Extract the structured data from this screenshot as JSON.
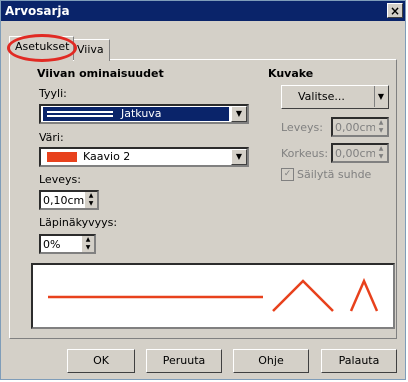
{
  "window": {
    "title": "Arvosarja",
    "close_glyph": "×"
  },
  "tabs": [
    {
      "label": "Asetukset"
    },
    {
      "label": "Viiva"
    }
  ],
  "line_props": {
    "heading": "Viivan ominaisuudet",
    "style_label": "Tyyli:",
    "style_value": "Jatkuva",
    "color_label": "Väri:",
    "color_value": "Kaavio 2",
    "color_swatch": "#e8411c",
    "width_label": "Leveys:",
    "width_value": "0,10cm",
    "transparency_label": "Läpinäkyvyys:",
    "transparency_value": "0%"
  },
  "icon": {
    "heading": "Kuvake",
    "select_label": "Valitse...",
    "width_label": "Leveys:",
    "width_value": "0,00cm",
    "height_label": "Korkeus:",
    "height_value": "0,00cm",
    "keep_ratio_label": "Säilytä suhde"
  },
  "buttons": {
    "ok": "OK",
    "cancel": "Peruuta",
    "help": "Ohje",
    "reset": "Palauta"
  },
  "colors": {
    "line_red": "#e8411c",
    "title_bar": "#0a246a",
    "dialog_bg": "#d4d0c8"
  }
}
